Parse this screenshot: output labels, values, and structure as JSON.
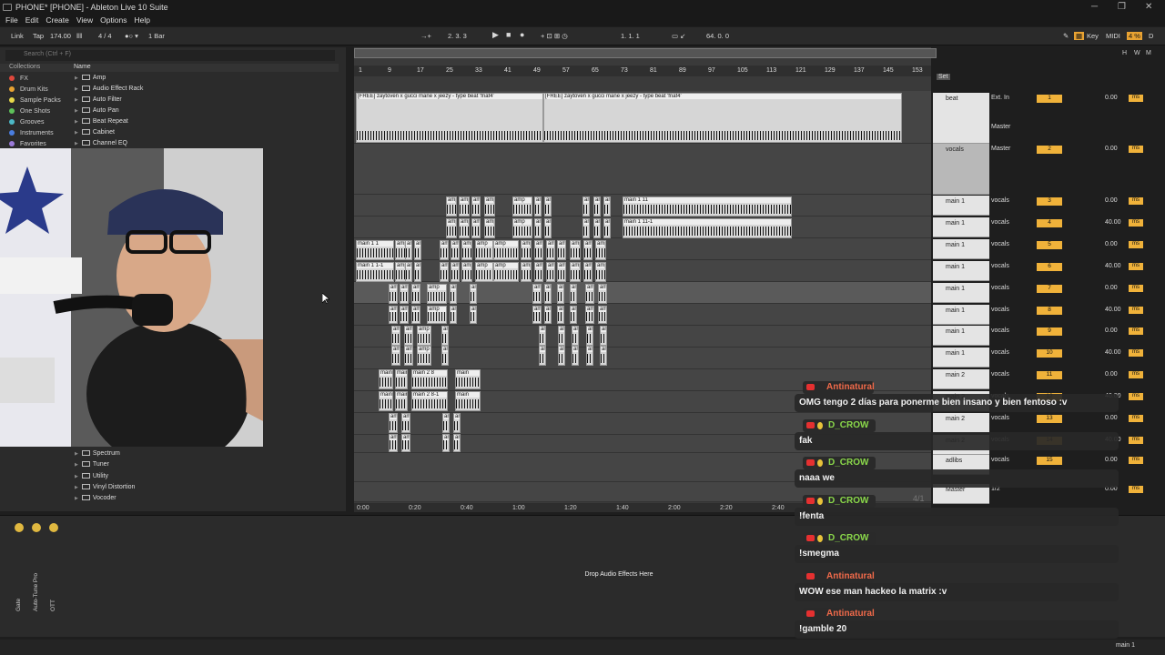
{
  "window": {
    "title": "PHONE*  [PHONE]  - Ableton Live 10 Suite"
  },
  "menu": [
    "File",
    "Edit",
    "Create",
    "View",
    "Options",
    "Help"
  ],
  "control": {
    "link": "Link",
    "tap": "Tap",
    "tempo": "174.00",
    "meter": "4 / 4",
    "quant": "1 Bar",
    "position": "2.  3.  3",
    "loop_start": "1.  1.  1",
    "loop_len": "64.  0.  0",
    "key": "Key",
    "midi": "MIDI",
    "cpu": "4 %",
    "d": "D"
  },
  "browser": {
    "search_placeholder": "Search (Ctrl + F)",
    "col_collections": "Collections",
    "col_name": "Name",
    "collections": [
      {
        "label": "FX",
        "color": "#e0483c"
      },
      {
        "label": "Drum Kits",
        "color": "#e8a232"
      },
      {
        "label": "Sample Packs",
        "color": "#e8d84a"
      },
      {
        "label": "One Shots",
        "color": "#5ec25a"
      },
      {
        "label": "Grooves",
        "color": "#4cb8c6"
      },
      {
        "label": "Instruments",
        "color": "#4a7ee0"
      },
      {
        "label": "Favorites",
        "color": "#9a7ad8"
      }
    ],
    "items_top": [
      "Amp",
      "Audio Effect Rack",
      "Auto Filter",
      "Auto Pan",
      "Beat Repeat",
      "Cabinet",
      "Channel EQ"
    ],
    "items_bottom": [
      "Spectrum",
      "Tuner",
      "Utility",
      "Vinyl Distortion",
      "Vocoder"
    ]
  },
  "ruler": [
    "1",
    "9",
    "17",
    "25",
    "33",
    "41",
    "49",
    "57",
    "65",
    "73",
    "81",
    "89",
    "97",
    "105",
    "113",
    "121",
    "129",
    "137",
    "145",
    "153"
  ],
  "times": [
    "0:00",
    "0:20",
    "0:40",
    "1:00",
    "1:20",
    "1:40",
    "2:00",
    "2:20",
    "2:40"
  ],
  "clips": {
    "beat_a": "[FREE] zaytoven x gucci mane x jeezy - type beat 'fnaf4'",
    "beat_b": "[FREE] zaytoven x gucci mane x jeezy - type beat 'fnaf4'",
    "main_11": "main 1 11",
    "main_11_1": "main 1 11-1",
    "main_1": "main 1 1",
    "main_1_1": "main 1 1-1",
    "main_28": "main 2 8",
    "main_28_1": "main 2 8-1",
    "amp": "amp",
    "main": "main"
  },
  "set_label": "Set",
  "tracks": [
    {
      "name": "beat",
      "io": "Ext. In",
      "out": "Master",
      "num": "1",
      "vol": "0.00"
    },
    {
      "name": "vocals",
      "io": "Master",
      "out": "",
      "num": "2",
      "vol": "0.00"
    },
    {
      "name": "main 1",
      "io": "vocals",
      "out": "",
      "num": "3",
      "vol": "0.00"
    },
    {
      "name": "main 1",
      "io": "vocals",
      "out": "",
      "num": "4",
      "vol": "40.00"
    },
    {
      "name": "main 1",
      "io": "vocals",
      "out": "",
      "num": "5",
      "vol": "0.00"
    },
    {
      "name": "main 1",
      "io": "vocals",
      "out": "",
      "num": "6",
      "vol": "40.00"
    },
    {
      "name": "main 1",
      "io": "vocals",
      "out": "",
      "num": "7",
      "vol": "0.00"
    },
    {
      "name": "main 1",
      "io": "vocals",
      "out": "",
      "num": "8",
      "vol": "40.00"
    },
    {
      "name": "main 1",
      "io": "vocals",
      "out": "",
      "num": "9",
      "vol": "0.00"
    },
    {
      "name": "main 1",
      "io": "vocals",
      "out": "",
      "num": "10",
      "vol": "40.00"
    },
    {
      "name": "main 2",
      "io": "vocals",
      "out": "",
      "num": "11",
      "vol": "0.00"
    },
    {
      "name": "main 2",
      "io": "vocals",
      "out": "",
      "num": "12",
      "vol": "40.00"
    },
    {
      "name": "main 2",
      "io": "vocals",
      "out": "",
      "num": "13",
      "vol": "0.00"
    },
    {
      "name": "main 2",
      "io": "vocals",
      "out": "",
      "num": "14",
      "vol": "40.00"
    },
    {
      "name": "adlibs",
      "io": "vocals",
      "out": "",
      "num": "15",
      "vol": "0.00"
    },
    {
      "name": "Master",
      "io": "1/2",
      "out": "",
      "num": "",
      "vol": "0.00"
    }
  ],
  "ms_label": "ms",
  "device": {
    "drop": "Drop Audio Effects Here",
    "labels": [
      "Gate",
      "Auto-Tune Pro",
      "OTT"
    ]
  },
  "status": {
    "track": "main 1",
    "counter": "4/1"
  },
  "chat": [
    {
      "user": "Antinatural",
      "color": "#f06a4a",
      "msg": "OMG tengo 2 días para ponerme bien insano y bien fentoso :v",
      "badge": false
    },
    {
      "user": "D_CROW",
      "color": "#8ad84a",
      "msg": "fak",
      "badge": true
    },
    {
      "user": "D_CROW",
      "color": "#8ad84a",
      "msg": "naaa we",
      "badge": true
    },
    {
      "user": "D_CROW",
      "color": "#8ad84a",
      "msg": "!fenta",
      "badge": true
    },
    {
      "user": "D_CROW",
      "color": "#8ad84a",
      "msg": "!smegma",
      "badge": true
    },
    {
      "user": "Antinatural",
      "color": "#f06a4a",
      "msg": "WOW ese man hackeo la matrix :v",
      "badge": false
    },
    {
      "user": "Antinatural",
      "color": "#f06a4a",
      "msg": "!gamble 20",
      "badge": false
    }
  ]
}
